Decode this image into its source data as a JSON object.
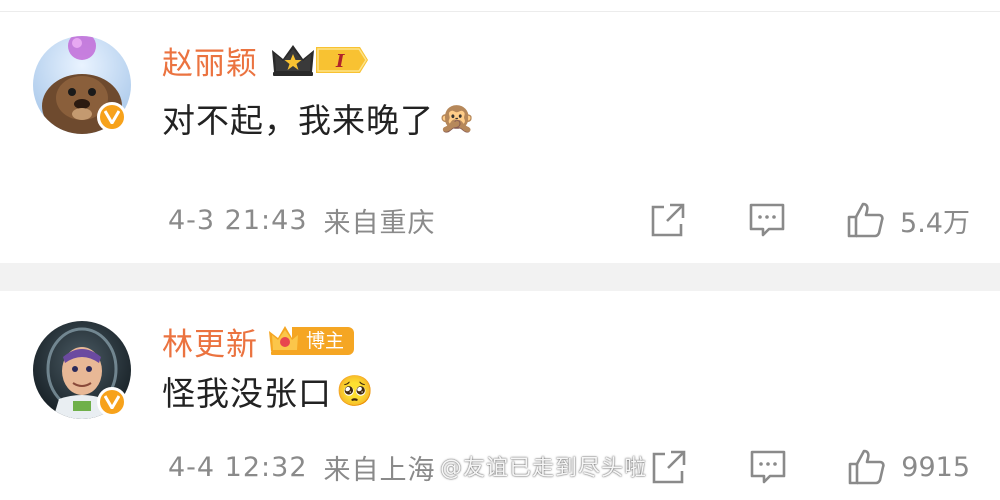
{
  "comments": [
    {
      "username": "赵丽颖",
      "vip_level": "I",
      "text": "对不起，我来晚了",
      "emoji": "🙊",
      "date": "4-3 21:43",
      "location": "来自重庆",
      "likes": "5.4万",
      "verified_label": "V"
    },
    {
      "username": "林更新",
      "owner_badge": "博主",
      "text": "怪我没张口",
      "emoji": "🥺",
      "date": "4-4 12:32",
      "location": "来自上海",
      "likes": "9915",
      "verified_label": "V"
    }
  ],
  "watermark": "@友谊已走到尽头啦",
  "colors": {
    "username": "#eb7340",
    "meta": "#8a8a8a",
    "verified": "#f7a21b",
    "separator": "#f2f2f2"
  },
  "icons": [
    "share-icon",
    "comment-icon",
    "like-icon",
    "crown-icon",
    "verified-v-icon"
  ]
}
